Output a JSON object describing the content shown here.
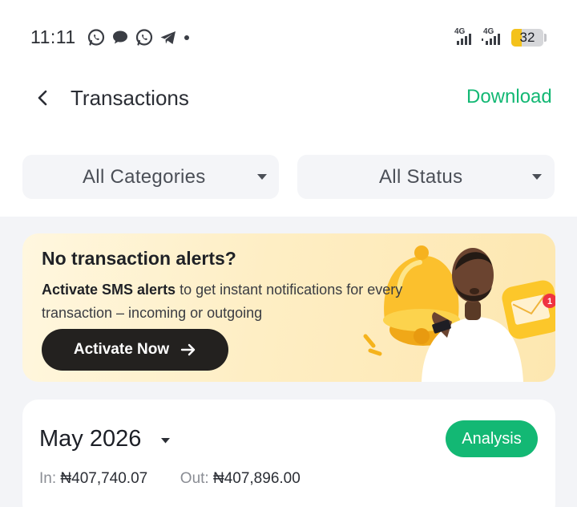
{
  "status_bar": {
    "time": "11:11",
    "notification_icons": [
      "whatsapp-icon",
      "chat-bubble-icon",
      "whatsapp-icon",
      "telegram-icon"
    ],
    "signal_labels": [
      "4G",
      "4G"
    ],
    "battery": "32",
    "battery_level": 0.32
  },
  "header": {
    "title": "Transactions",
    "download_label": "Download"
  },
  "filters": {
    "category": "All Categories",
    "status": "All Status"
  },
  "banner": {
    "title": "No transaction alerts?",
    "body_bold": "Activate SMS alerts",
    "body_rest": " to get instant notifications for every transaction – incoming or outgoing",
    "button_label": "Activate Now",
    "envelope_badge": "1"
  },
  "summary": {
    "month": "May 2026",
    "analysis_label": "Analysis",
    "in_label": "In:",
    "in_value": "₦407,740.07",
    "out_label": "Out:",
    "out_value": "₦407,896.00"
  },
  "colors": {
    "brand_green": "#13b874",
    "banner_button": "#23211f",
    "battery_fill": "#f4c21b"
  }
}
